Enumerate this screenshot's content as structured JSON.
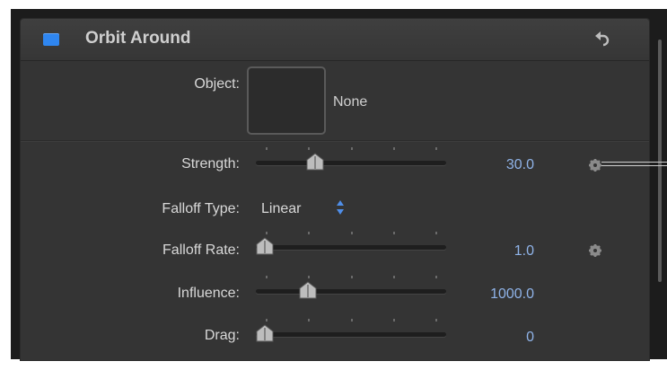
{
  "header": {
    "title": "Orbit Around",
    "checkbox_color": "#2f86f0",
    "reset_icon": "reset-arrow-icon"
  },
  "object": {
    "label": "Object:",
    "value": "None"
  },
  "strength": {
    "label": "Strength:",
    "value": "30.0",
    "slider_fraction": 0.3,
    "gear_icon": "gear-icon"
  },
  "falloff_type": {
    "label": "Falloff Type:",
    "value": "Linear",
    "arrows_icon": "popup-arrows-icon"
  },
  "falloff_rate": {
    "label": "Falloff Rate:",
    "value": "1.0",
    "slider_fraction": 0.0,
    "gear_icon": "gear-icon"
  },
  "influence": {
    "label": "Influence:",
    "value": "1000.0",
    "slider_fraction": 0.26
  },
  "drag": {
    "label": "Drag:",
    "value": "0",
    "slider_fraction": 0.0
  },
  "colors": {
    "value_text": "#8fb3e8",
    "accent": "#2f86f0",
    "panel": "#343434"
  }
}
